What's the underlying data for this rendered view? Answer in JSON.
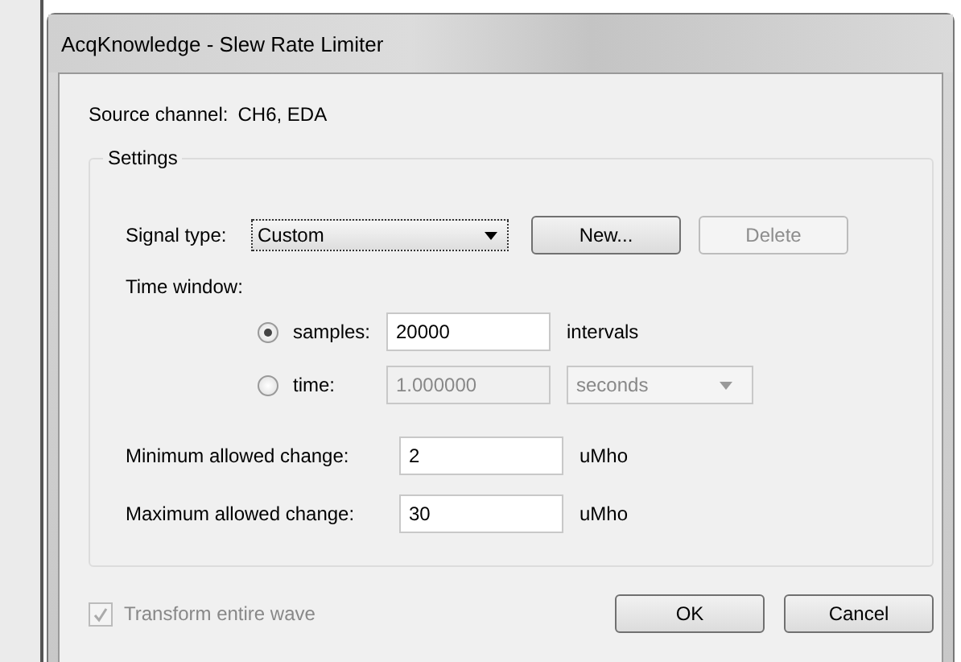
{
  "window": {
    "title": "AcqKnowledge - Slew Rate Limiter"
  },
  "source_channel": {
    "label": "Source channel:",
    "value": "CH6, EDA"
  },
  "settings": {
    "title": "Settings",
    "signal_type": {
      "label": "Signal type:",
      "value": "Custom"
    },
    "signal_buttons": [
      {
        "label": "New...",
        "disabled": false
      },
      {
        "label": "Delete",
        "disabled": true
      }
    ],
    "time_window": {
      "label": "Time window:",
      "options": [
        {
          "label": "samples:",
          "selected": true,
          "value": "20000",
          "kind": "text",
          "unit": "intervals"
        },
        {
          "label": "time:",
          "selected": false,
          "value": "1.000000",
          "kind": "select",
          "unit": "seconds"
        }
      ]
    },
    "limits": [
      {
        "label": "Minimum allowed change:",
        "value": "2",
        "unit": "uMho"
      },
      {
        "label": "Maximum allowed change:",
        "value": "30",
        "unit": "uMho"
      }
    ]
  },
  "transform": {
    "label": "Transform entire wave",
    "checked": true,
    "disabled": true
  },
  "buttons": [
    "OK",
    "Cancel"
  ]
}
